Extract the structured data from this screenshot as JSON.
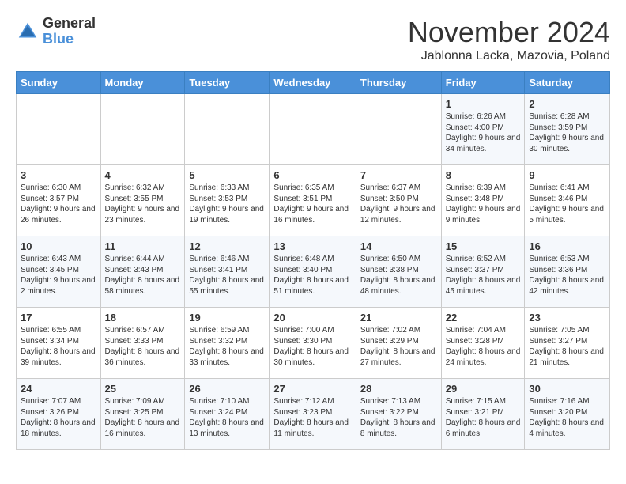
{
  "header": {
    "logo": {
      "general": "General",
      "blue": "Blue"
    },
    "title": "November 2024",
    "subtitle": "Jablonna Lacka, Mazovia, Poland"
  },
  "days_of_week": [
    "Sunday",
    "Monday",
    "Tuesday",
    "Wednesday",
    "Thursday",
    "Friday",
    "Saturday"
  ],
  "weeks": [
    [
      {
        "day": "",
        "info": ""
      },
      {
        "day": "",
        "info": ""
      },
      {
        "day": "",
        "info": ""
      },
      {
        "day": "",
        "info": ""
      },
      {
        "day": "",
        "info": ""
      },
      {
        "day": "1",
        "info": "Sunrise: 6:26 AM\nSunset: 4:00 PM\nDaylight: 9 hours and 34 minutes."
      },
      {
        "day": "2",
        "info": "Sunrise: 6:28 AM\nSunset: 3:59 PM\nDaylight: 9 hours and 30 minutes."
      }
    ],
    [
      {
        "day": "3",
        "info": "Sunrise: 6:30 AM\nSunset: 3:57 PM\nDaylight: 9 hours and 26 minutes."
      },
      {
        "day": "4",
        "info": "Sunrise: 6:32 AM\nSunset: 3:55 PM\nDaylight: 9 hours and 23 minutes."
      },
      {
        "day": "5",
        "info": "Sunrise: 6:33 AM\nSunset: 3:53 PM\nDaylight: 9 hours and 19 minutes."
      },
      {
        "day": "6",
        "info": "Sunrise: 6:35 AM\nSunset: 3:51 PM\nDaylight: 9 hours and 16 minutes."
      },
      {
        "day": "7",
        "info": "Sunrise: 6:37 AM\nSunset: 3:50 PM\nDaylight: 9 hours and 12 minutes."
      },
      {
        "day": "8",
        "info": "Sunrise: 6:39 AM\nSunset: 3:48 PM\nDaylight: 9 hours and 9 minutes."
      },
      {
        "day": "9",
        "info": "Sunrise: 6:41 AM\nSunset: 3:46 PM\nDaylight: 9 hours and 5 minutes."
      }
    ],
    [
      {
        "day": "10",
        "info": "Sunrise: 6:43 AM\nSunset: 3:45 PM\nDaylight: 9 hours and 2 minutes."
      },
      {
        "day": "11",
        "info": "Sunrise: 6:44 AM\nSunset: 3:43 PM\nDaylight: 8 hours and 58 minutes."
      },
      {
        "day": "12",
        "info": "Sunrise: 6:46 AM\nSunset: 3:41 PM\nDaylight: 8 hours and 55 minutes."
      },
      {
        "day": "13",
        "info": "Sunrise: 6:48 AM\nSunset: 3:40 PM\nDaylight: 8 hours and 51 minutes."
      },
      {
        "day": "14",
        "info": "Sunrise: 6:50 AM\nSunset: 3:38 PM\nDaylight: 8 hours and 48 minutes."
      },
      {
        "day": "15",
        "info": "Sunrise: 6:52 AM\nSunset: 3:37 PM\nDaylight: 8 hours and 45 minutes."
      },
      {
        "day": "16",
        "info": "Sunrise: 6:53 AM\nSunset: 3:36 PM\nDaylight: 8 hours and 42 minutes."
      }
    ],
    [
      {
        "day": "17",
        "info": "Sunrise: 6:55 AM\nSunset: 3:34 PM\nDaylight: 8 hours and 39 minutes."
      },
      {
        "day": "18",
        "info": "Sunrise: 6:57 AM\nSunset: 3:33 PM\nDaylight: 8 hours and 36 minutes."
      },
      {
        "day": "19",
        "info": "Sunrise: 6:59 AM\nSunset: 3:32 PM\nDaylight: 8 hours and 33 minutes."
      },
      {
        "day": "20",
        "info": "Sunrise: 7:00 AM\nSunset: 3:30 PM\nDaylight: 8 hours and 30 minutes."
      },
      {
        "day": "21",
        "info": "Sunrise: 7:02 AM\nSunset: 3:29 PM\nDaylight: 8 hours and 27 minutes."
      },
      {
        "day": "22",
        "info": "Sunrise: 7:04 AM\nSunset: 3:28 PM\nDaylight: 8 hours and 24 minutes."
      },
      {
        "day": "23",
        "info": "Sunrise: 7:05 AM\nSunset: 3:27 PM\nDaylight: 8 hours and 21 minutes."
      }
    ],
    [
      {
        "day": "24",
        "info": "Sunrise: 7:07 AM\nSunset: 3:26 PM\nDaylight: 8 hours and 18 minutes."
      },
      {
        "day": "25",
        "info": "Sunrise: 7:09 AM\nSunset: 3:25 PM\nDaylight: 8 hours and 16 minutes."
      },
      {
        "day": "26",
        "info": "Sunrise: 7:10 AM\nSunset: 3:24 PM\nDaylight: 8 hours and 13 minutes."
      },
      {
        "day": "27",
        "info": "Sunrise: 7:12 AM\nSunset: 3:23 PM\nDaylight: 8 hours and 11 minutes."
      },
      {
        "day": "28",
        "info": "Sunrise: 7:13 AM\nSunset: 3:22 PM\nDaylight: 8 hours and 8 minutes."
      },
      {
        "day": "29",
        "info": "Sunrise: 7:15 AM\nSunset: 3:21 PM\nDaylight: 8 hours and 6 minutes."
      },
      {
        "day": "30",
        "info": "Sunrise: 7:16 AM\nSunset: 3:20 PM\nDaylight: 8 hours and 4 minutes."
      }
    ]
  ]
}
